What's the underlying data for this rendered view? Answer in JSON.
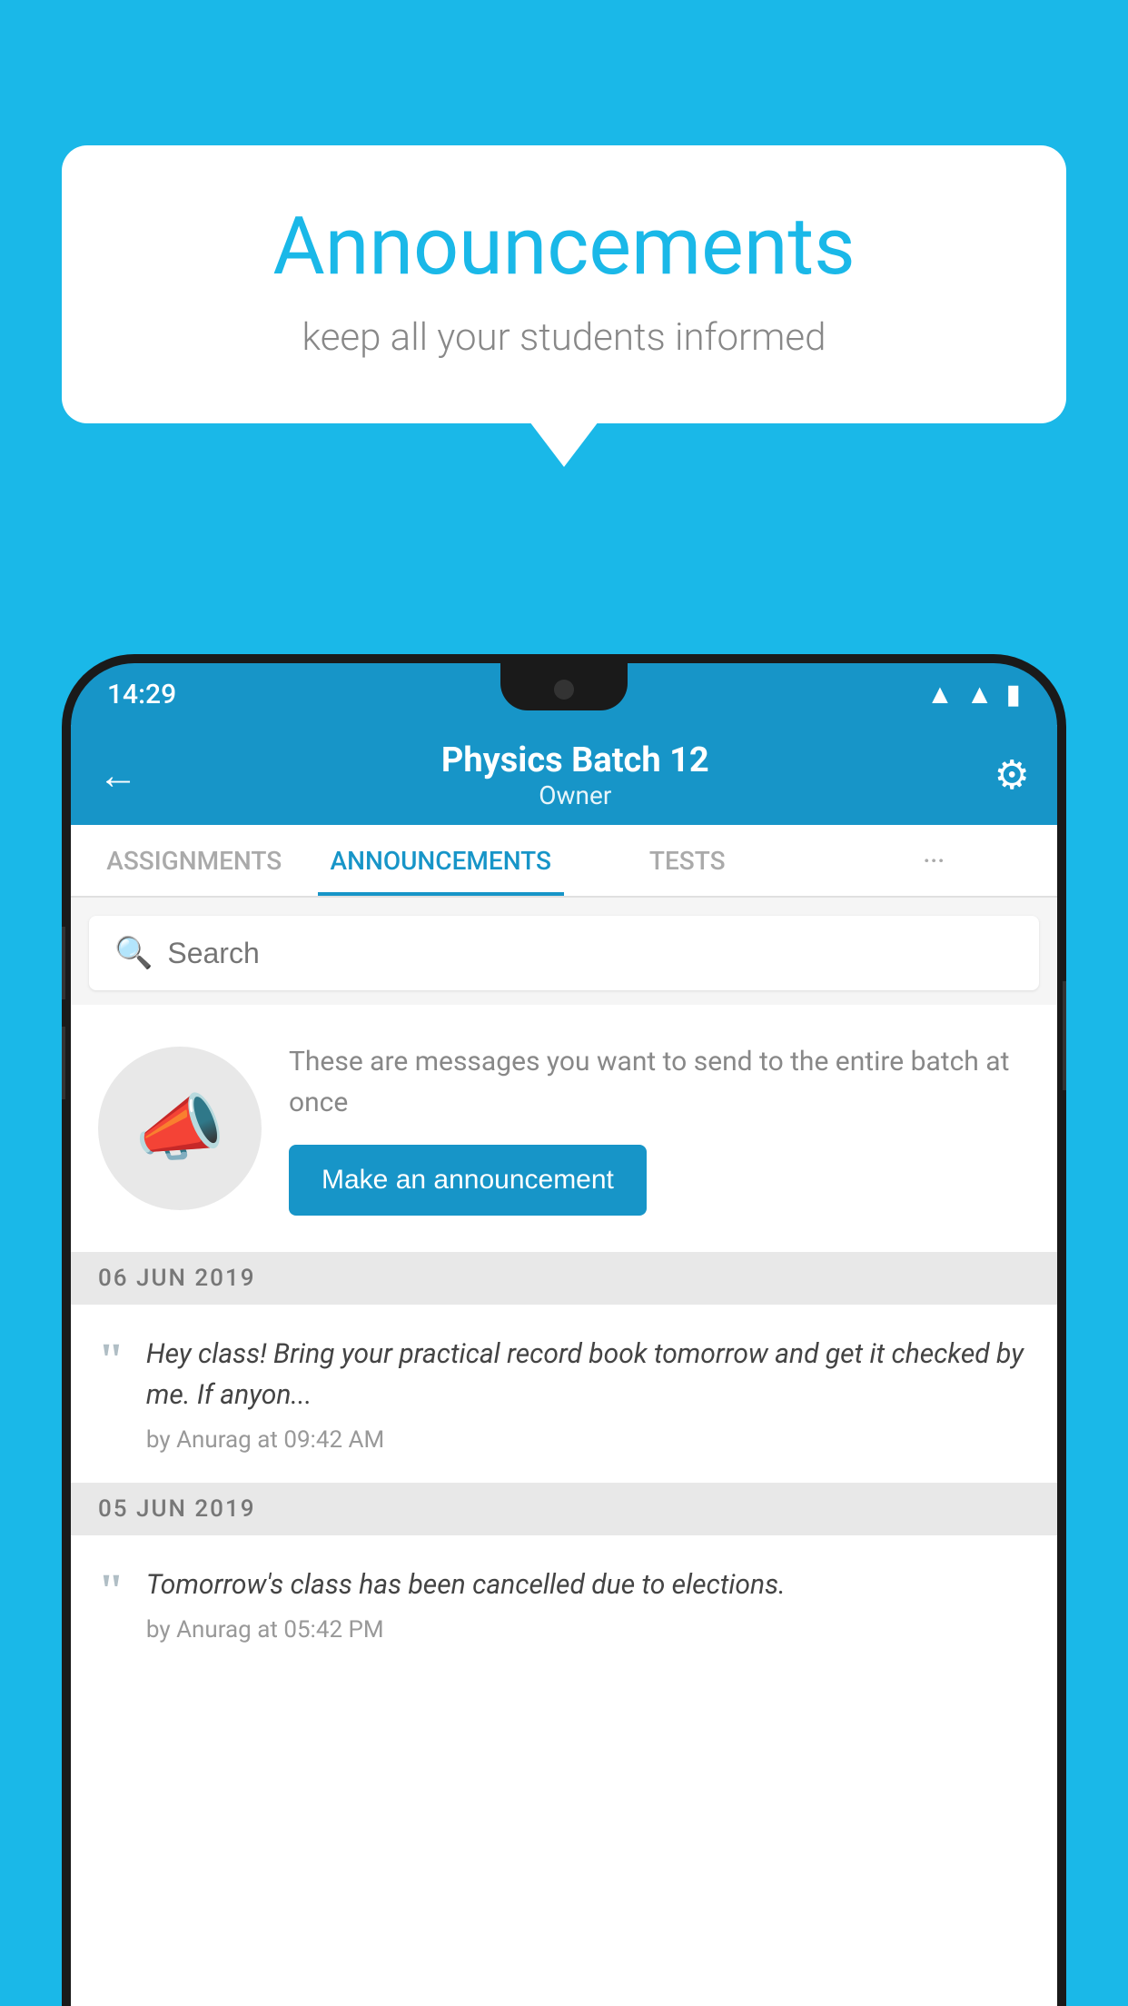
{
  "background_color": "#1ab8e8",
  "speech_bubble": {
    "title": "Announcements",
    "subtitle": "keep all your students informed"
  },
  "phone": {
    "status_bar": {
      "time": "14:29"
    },
    "app_bar": {
      "title": "Physics Batch 12",
      "subtitle": "Owner",
      "back_label": "←",
      "settings_label": "⚙"
    },
    "tabs": [
      {
        "label": "ASSIGNMENTS",
        "active": false
      },
      {
        "label": "ANNOUNCEMENTS",
        "active": true
      },
      {
        "label": "TESTS",
        "active": false
      },
      {
        "label": "···",
        "active": false
      }
    ],
    "search": {
      "placeholder": "Search"
    },
    "promo_card": {
      "description": "These are messages you want to send to the entire batch at once",
      "button_label": "Make an announcement"
    },
    "announcements": [
      {
        "date": "06  JUN  2019",
        "messages": [
          {
            "text": "Hey class! Bring your practical record book tomorrow and get it checked by me. If anyon...",
            "author": "by Anurag at 09:42 AM"
          }
        ]
      },
      {
        "date": "05  JUN  2019",
        "messages": [
          {
            "text": "Tomorrow's class has been cancelled due to elections.",
            "author": "by Anurag at 05:42 PM"
          }
        ]
      }
    ]
  }
}
